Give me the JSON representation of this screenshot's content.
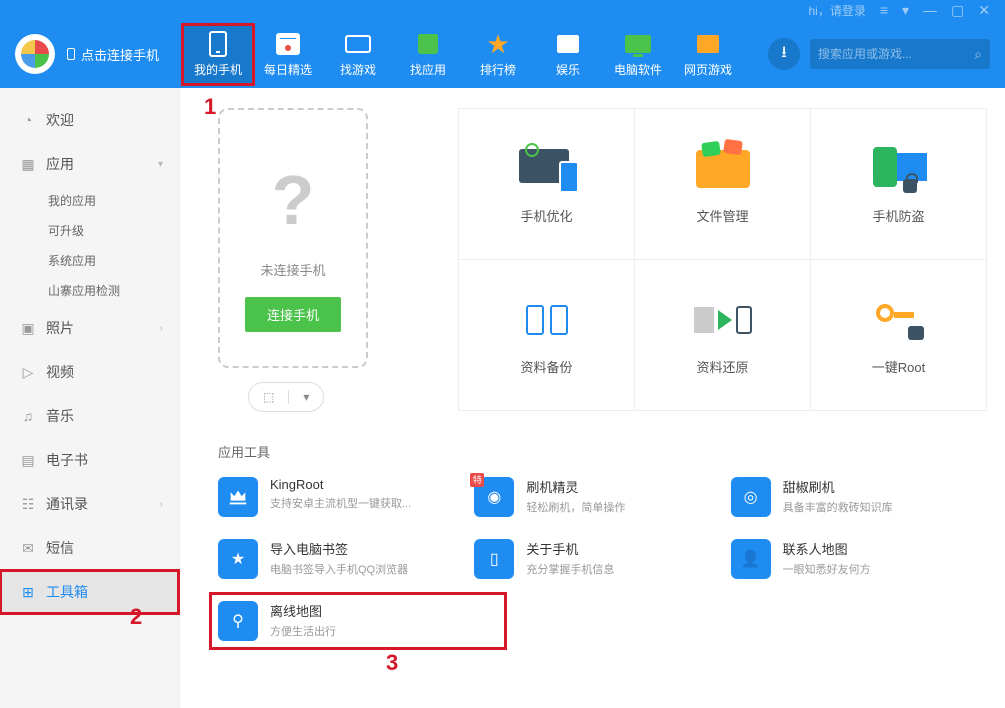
{
  "titlebar": {
    "login_text": "hi，请登录",
    "connect_tip": "点击连接手机"
  },
  "nav": [
    {
      "label": "我的手机",
      "icon": "phone"
    },
    {
      "label": "每日精选",
      "icon": "cal"
    },
    {
      "label": "找游戏",
      "icon": "game"
    },
    {
      "label": "找应用",
      "icon": "bag"
    },
    {
      "label": "排行榜",
      "icon": "star"
    },
    {
      "label": "娱乐",
      "icon": "video"
    },
    {
      "label": "电脑软件",
      "icon": "pc"
    },
    {
      "label": "网页游戏",
      "icon": "web"
    }
  ],
  "search": {
    "placeholder": "搜索应用或游戏..."
  },
  "sidebar": {
    "welcome": "欢迎",
    "apps": "应用",
    "app_subs": [
      "我的应用",
      "可升级",
      "系统应用",
      "山寨应用检测"
    ],
    "photos": "照片",
    "videos": "视频",
    "music": "音乐",
    "ebooks": "电子书",
    "contacts": "通讯录",
    "sms": "短信",
    "toolbox": "工具箱"
  },
  "phone_panel": {
    "status": "未连接手机",
    "connect_btn": "连接手机"
  },
  "cards": [
    "手机优化",
    "文件管理",
    "手机防盗",
    "资料备份",
    "资料还原",
    "一键Root"
  ],
  "tools_section_title": "应用工具",
  "tools": [
    {
      "title": "KingRoot",
      "desc": "支持安卓主流机型一键获取...",
      "icon": "crown"
    },
    {
      "title": "刷机精灵",
      "desc": "轻松刷机，简单操作",
      "icon": "shield",
      "badge": "特"
    },
    {
      "title": "甜椒刷机",
      "desc": "具备丰富的救砖知识库",
      "icon": "target"
    },
    {
      "title": "导入电脑书签",
      "desc": "电脑书签导入手机QQ浏览器",
      "icon": "bookmark"
    },
    {
      "title": "关于手机",
      "desc": "充分掌握手机信息",
      "icon": "phone-info"
    },
    {
      "title": "联系人地图",
      "desc": "一眼知悉好友何方",
      "icon": "person"
    },
    {
      "title": "离线地图",
      "desc": "方便生活出行",
      "icon": "map-pin"
    }
  ],
  "annotations": {
    "1": "1",
    "2": "2",
    "3": "3"
  },
  "chevron_down": "▾",
  "chevron_right": "›"
}
